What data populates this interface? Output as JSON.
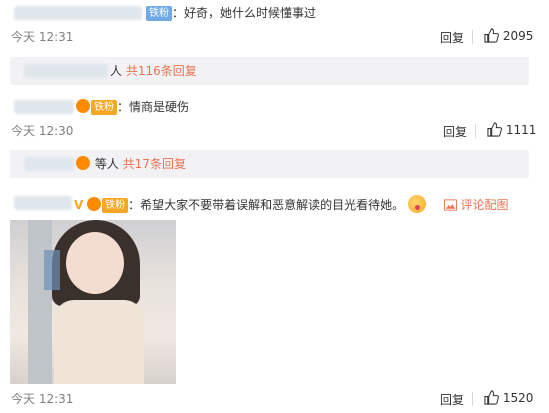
{
  "comment1": {
    "badge": "铁粉",
    "text": "：好奇，她什么时候懂事过",
    "time": "今天 12:31",
    "reply": "回复",
    "likes": "2095",
    "replies_suffix": "人",
    "replies_link": "共116条回复"
  },
  "comment2": {
    "badge": "铁粉",
    "text": "：情商是硬伤",
    "time": "今天 12:30",
    "reply": "回复",
    "likes": "1111",
    "replies_suffix": "等人",
    "replies_link": "共17条回复"
  },
  "comment3": {
    "badge": "铁粉",
    "text": "：希望大家不要带着误解和恶意解读的目光看待她。",
    "view_image": "评论配图",
    "time": "今天 12:31",
    "reply": "回复",
    "likes": "1520"
  },
  "icons": {
    "like": "thumbs-up-icon",
    "image": "image-icon",
    "vip": "verified-v-icon",
    "crown": "fan-crown-icon",
    "emoji": "blush-emoji-icon"
  }
}
